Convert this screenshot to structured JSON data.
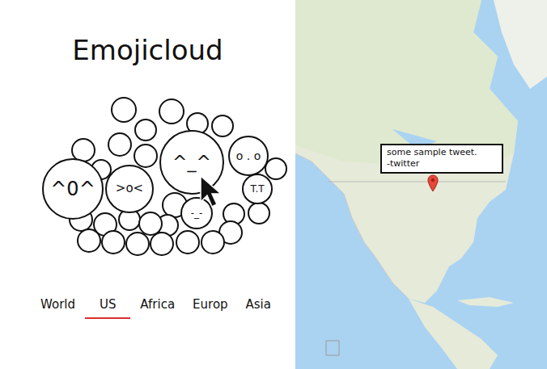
{
  "app": {
    "title": "Emojicloud"
  },
  "emojis": [
    {
      "text": "^0^"
    },
    {
      "text": ">o<"
    },
    {
      "text": "^_^"
    },
    {
      "text": "o . o"
    },
    {
      "text": "T.T"
    },
    {
      "text": "-_-"
    }
  ],
  "tabs": [
    {
      "label": "World",
      "selected": false
    },
    {
      "label": "US",
      "selected": true
    },
    {
      "label": "Africa",
      "selected": false
    },
    {
      "label": "Europ",
      "selected": false
    },
    {
      "label": "Asia",
      "selected": false
    }
  ],
  "map": {
    "tooltip": {
      "text": "some sample tweet.",
      "source": "-twitter"
    }
  }
}
